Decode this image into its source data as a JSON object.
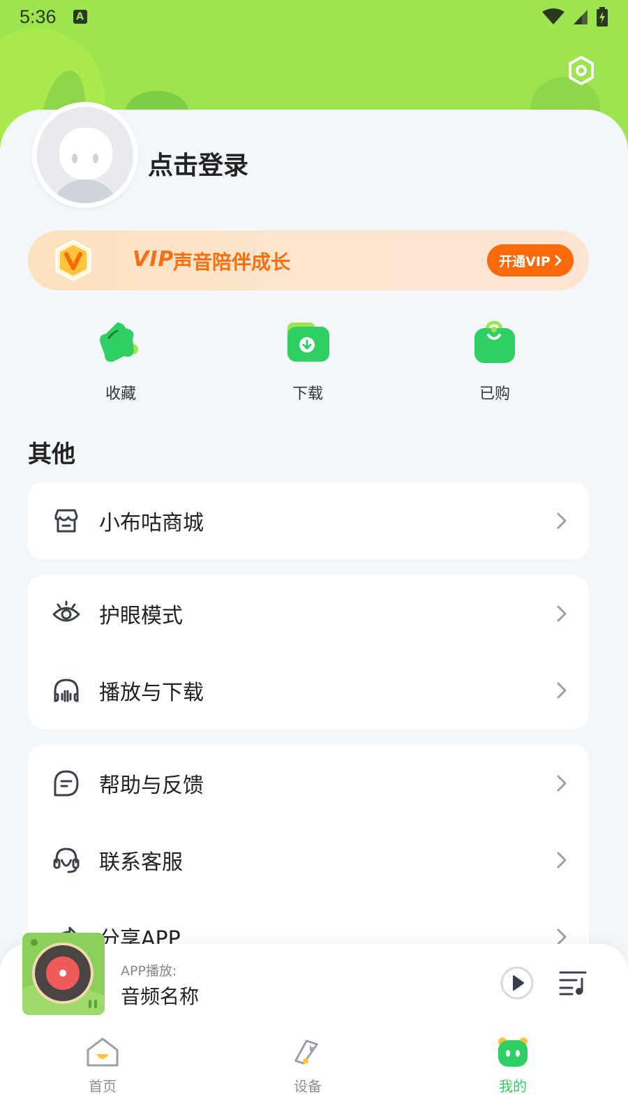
{
  "status_bar": {
    "time": "5:36",
    "a_badge": "A"
  },
  "profile": {
    "login_label": "点击登录"
  },
  "vip": {
    "logo": "VIP",
    "slogan": "声音陪伴成长",
    "button": "开通VIP"
  },
  "quick_actions": [
    {
      "label": "收藏",
      "icon": "favorite-star-icon"
    },
    {
      "label": "下载",
      "icon": "download-folder-icon"
    },
    {
      "label": "已购",
      "icon": "purchased-bag-icon"
    }
  ],
  "section_title": "其他",
  "groups": [
    [
      {
        "label": "小布咕商城",
        "icon": "store-icon"
      }
    ],
    [
      {
        "label": "护眼模式",
        "icon": "eye-icon"
      },
      {
        "label": "播放与下载",
        "icon": "headphones-icon"
      }
    ],
    [
      {
        "label": "帮助与反馈",
        "icon": "feedback-chat-icon"
      },
      {
        "label": "联系客服",
        "icon": "customer-service-icon"
      },
      {
        "label": "分享APP",
        "icon": "share-icon"
      }
    ]
  ],
  "player": {
    "source": "APP播放:",
    "title": "音频名称"
  },
  "tabs": [
    {
      "label": "首页",
      "icon": "home-icon",
      "active": false
    },
    {
      "label": "设备",
      "icon": "device-icon",
      "active": false
    },
    {
      "label": "我的",
      "icon": "mine-icon",
      "active": true
    }
  ],
  "colors": {
    "brand_green": "#2fcf63",
    "header_green": "#9ee44f",
    "vip_orange": "#fb6a0a"
  }
}
